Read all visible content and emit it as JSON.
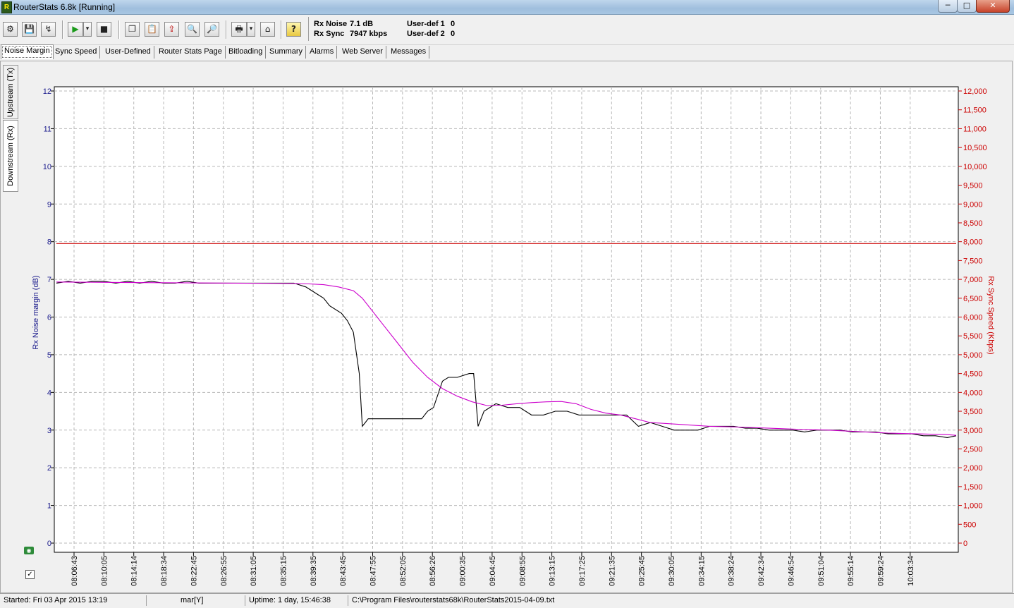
{
  "window": {
    "title": "RouterStats 6.8k   [Running]",
    "icon": "router-stats-app-icon",
    "icon_glyph": "R",
    "controls": {
      "minimize": "─",
      "maximize": "□",
      "close": "✕"
    }
  },
  "toolbar": {
    "buttons": [
      {
        "name": "settings-icon",
        "glyph": "⚙"
      },
      {
        "name": "save-icon",
        "glyph": "💾"
      },
      {
        "name": "connect-icon",
        "glyph": "↯"
      },
      {
        "name": "play-icon",
        "glyph": "▶"
      },
      {
        "name": "play-dropdown-icon",
        "glyph": "▾"
      },
      {
        "name": "stop-icon",
        "glyph": "■"
      },
      {
        "name": "copy-icon",
        "glyph": "❐"
      },
      {
        "name": "paste-icon",
        "glyph": "📋"
      },
      {
        "name": "export-icon",
        "glyph": "⇪"
      },
      {
        "name": "zoom-icon",
        "glyph": "🔍"
      },
      {
        "name": "zoom-page-icon",
        "glyph": "🔎"
      },
      {
        "name": "print-icon",
        "glyph": "🖶"
      },
      {
        "name": "print-dropdown-icon",
        "glyph": "▾"
      },
      {
        "name": "home-icon",
        "glyph": "⌂"
      },
      {
        "name": "help-icon",
        "glyph": "?"
      }
    ],
    "status": {
      "rx_noise_label": "Rx Noise",
      "rx_noise_value": "7.1 dB",
      "rx_sync_label": "Rx Sync",
      "rx_sync_value": "7947 kbps",
      "user_def1_label": "User-def 1",
      "user_def1_value": "0",
      "user_def2_label": "User-def 2",
      "user_def2_value": "0"
    }
  },
  "tabs": [
    {
      "label": "Noise Margin",
      "active": true
    },
    {
      "label": "Sync Speed",
      "active": false
    },
    {
      "label": "User-Defined",
      "active": false
    },
    {
      "label": "Router Stats Page",
      "active": false
    },
    {
      "label": "Bitloading",
      "active": false
    },
    {
      "label": "Summary",
      "active": false
    },
    {
      "label": "Alarms",
      "active": false
    },
    {
      "label": "Web Server",
      "active": false
    },
    {
      "label": "Messages",
      "active": false
    }
  ],
  "side_tabs": [
    {
      "label": "Upstream (Tx)",
      "active": false
    },
    {
      "label": "Downstream (Rx)",
      "active": true
    }
  ],
  "chart_data": {
    "type": "line",
    "xlabel": "",
    "ylabel": "Rx Noise margin (dB)",
    "y2label": "Rx Sync Speed (Kbps)",
    "ylim": [
      0,
      12
    ],
    "y2lim": [
      0,
      12000
    ],
    "y_ticks": [
      "0",
      "1",
      "2",
      "3",
      "4",
      "5",
      "6",
      "7",
      "8",
      "9",
      "10",
      "11",
      "12"
    ],
    "y2_ticks": [
      "0",
      "500",
      "1,000",
      "1,500",
      "2,000",
      "2,500",
      "3,000",
      "3,500",
      "4,000",
      "4,500",
      "5,000",
      "5,500",
      "6,000",
      "6,500",
      "7,000",
      "7,500",
      "8,000",
      "8,500",
      "9,000",
      "9,500",
      "10,000",
      "10,500",
      "11,000",
      "11,500",
      "12,000"
    ],
    "x_ticks": [
      "08:06:43",
      "08:10:05",
      "08:14:14",
      "08:18:34",
      "08:22:45",
      "08:26:55",
      "08:31:05",
      "08:35:15",
      "08:39:35",
      "08:43:45",
      "08:47:55",
      "08:52:05",
      "08:56:26",
      "09:00:35",
      "09:04:45",
      "09:08:55",
      "09:13:15",
      "09:17:25",
      "09:21:35",
      "09:25:45",
      "09:30:05",
      "09:34:15",
      "09:38:24",
      "09:42:34",
      "09:46:54",
      "09:51:04",
      "09:55:14",
      "09:59:24",
      "10:03:34"
    ],
    "grid": true,
    "colors": {
      "noise": "#000000",
      "sync": "#cc00cc",
      "reference": "#cc0000",
      "axis_right": "#cc0000",
      "axis_left_label": "#1a1a8c"
    },
    "series": [
      {
        "axis": "left",
        "x": [
          0,
          0.4,
          0.8,
          1.2,
          1.6,
          2.0,
          2.4,
          2.8,
          3.2,
          3.6,
          4.0,
          4.4,
          4.8,
          5.2,
          5.6,
          6.0,
          6.4,
          6.8,
          7.2,
          7.6,
          8.0,
          8.4,
          8.8,
          9.0,
          9.2,
          9.6,
          9.8,
          10.0,
          10.2,
          10.3,
          10.4,
          10.5,
          10.6,
          11.0,
          11.5,
          12.0,
          12.3,
          12.5,
          12.7,
          13.0,
          13.2,
          13.5,
          13.9,
          14.05,
          14.2,
          14.4,
          14.8,
          15.2,
          15.6,
          16.0,
          16.4,
          16.8,
          17.2,
          17.6,
          18.0,
          18.4,
          18.8,
          19.2,
          19.6,
          20.0,
          20.4,
          20.8,
          21.2,
          21.6,
          22.0,
          22.4,
          22.8,
          23.2,
          23.6,
          24.0,
          24.4,
          24.8,
          25.2,
          25.6,
          26.0,
          26.4,
          26.8,
          27.2,
          27.6,
          28.0,
          28.4,
          28.8,
          29.2,
          29.6,
          30.0,
          30.3
        ],
        "y": [
          6.9,
          6.95,
          6.9,
          6.95,
          6.95,
          6.9,
          6.95,
          6.9,
          6.95,
          6.9,
          6.9,
          6.95,
          6.9,
          6.9,
          6.9,
          6.9,
          6.9,
          6.9,
          6.9,
          6.9,
          6.9,
          6.8,
          6.6,
          6.5,
          6.3,
          6.1,
          5.9,
          5.6,
          4.5,
          3.1,
          3.2,
          3.3,
          3.3,
          3.3,
          3.3,
          3.3,
          3.3,
          3.5,
          3.6,
          4.3,
          4.4,
          4.4,
          4.5,
          4.5,
          3.1,
          3.5,
          3.7,
          3.6,
          3.6,
          3.4,
          3.4,
          3.5,
          3.5,
          3.4,
          3.4,
          3.4,
          3.4,
          3.4,
          3.1,
          3.2,
          3.1,
          3.0,
          3.0,
          3.0,
          3.1,
          3.1,
          3.1,
          3.05,
          3.05,
          3.0,
          3.0,
          3.0,
          2.95,
          3.0,
          3.0,
          3.0,
          2.95,
          2.95,
          2.95,
          2.9,
          2.9,
          2.9,
          2.85,
          2.85,
          2.8,
          2.85
        ]
      },
      {
        "axis": "right",
        "x": [
          0,
          2,
          4,
          6,
          8,
          8.5,
          9,
          9.5,
          10,
          10.3,
          10.6,
          11,
          11.5,
          12,
          12.5,
          13,
          13.5,
          14,
          14.5,
          15,
          15.5,
          16,
          16.5,
          17,
          17.5,
          18,
          18.5,
          19,
          19.5,
          20,
          21,
          22,
          23,
          24,
          25,
          26,
          27,
          28,
          29,
          30,
          30.3
        ],
        "y": [
          6930,
          6920,
          6910,
          6900,
          6890,
          6880,
          6860,
          6800,
          6700,
          6500,
          6200,
          5800,
          5300,
          4800,
          4400,
          4100,
          3900,
          3750,
          3650,
          3660,
          3700,
          3730,
          3750,
          3760,
          3700,
          3550,
          3450,
          3400,
          3300,
          3200,
          3150,
          3100,
          3080,
          3050,
          3020,
          3000,
          2960,
          2920,
          2900,
          2880,
          2860
        ]
      },
      {
        "axis": "left",
        "name": "",
        "x": [
          0,
          30.3
        ],
        "y": [
          7.95,
          7.95
        ]
      }
    ]
  },
  "side_icons": {
    "camera": "camera-icon",
    "camera_glyph": "◉",
    "check": "✓"
  },
  "statusbar": {
    "started": "Started: Fri 03 Apr 2015   13:19",
    "mode": "mar[Y]",
    "uptime": "Uptime: 1 day, 15:46:38",
    "file": "C:\\Program Files\\routerstats68k\\RouterStats2015-04-09.txt"
  }
}
